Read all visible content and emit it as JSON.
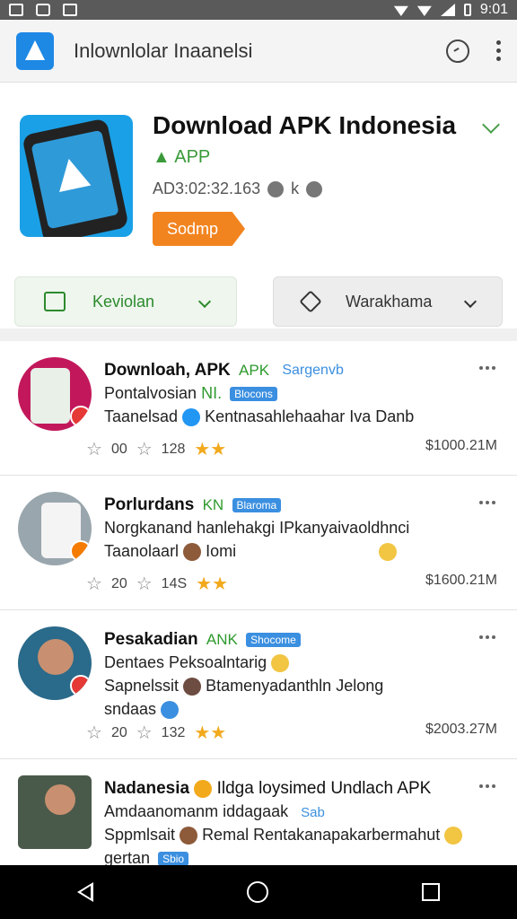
{
  "statusbar": {
    "time": "9:01"
  },
  "appbar": {
    "title": "Inlownlolar Inaanelsi"
  },
  "app": {
    "name": "Download APK Indonesia",
    "type": "APP",
    "meta": "AD3:02:32.163",
    "meta_k": "k",
    "badge": "Sodmp",
    "btn_left": "Keviolan",
    "btn_right": "Warakhama"
  },
  "items": [
    {
      "line1": "Downloah, APK",
      "line1_green": "APK",
      "line1_tag": "Sargenvb",
      "line2": "Pontalvosian",
      "line2_green": "NI.",
      "line2_tag": "Blocons",
      "line3": "Taanelsad",
      "line3_rest": "Kentnasahlehaahar Iva Danb",
      "rating1": "00",
      "rating2": "128",
      "size": "$1000.21M"
    },
    {
      "line1": "Porlurdans",
      "line1_green": "KN",
      "line1_tag": "Blaroma",
      "line2": "Norgkanand hanlehakgi IPkanyaivaoldhnci",
      "line3": "Taanolaarl",
      "line3_rest": "Iomi",
      "rating1": "20",
      "rating2": "14S",
      "size": "$1600.21M"
    },
    {
      "line1": "Pesakadian",
      "line1_green": "ANK",
      "line1_tag": "Shocome",
      "line2": "Dentaes Peksoalntarig",
      "line3": "Sapnelssit",
      "line3_rest": "Btamenyadanthln Jelong",
      "line4": "sndaas",
      "rating1": "20",
      "rating2": "132",
      "size": "$2003.27M"
    },
    {
      "line1": "Nadanesia",
      "line1_rest": "Ildga loysimed Undlach APK",
      "line2": "Amdaanomanm iddagaak",
      "line2_tag": "Sab",
      "line3": "Sppmlsait",
      "line3_rest": "Remal Rentakanapakarbermahut",
      "line4": "gertan",
      "line4_tag": "Sbio"
    }
  ]
}
